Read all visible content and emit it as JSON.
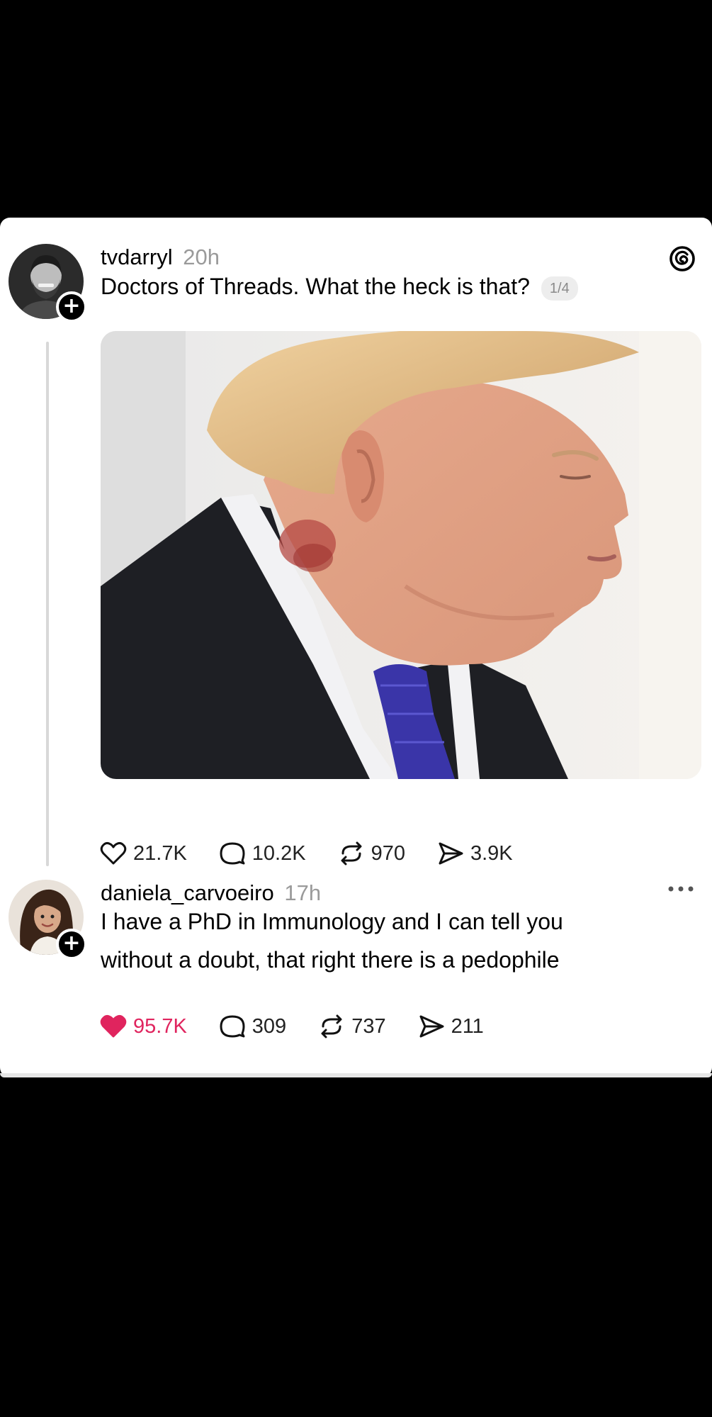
{
  "post": {
    "username": "tvdarryl",
    "time": "20h",
    "text": "Doctors of Threads. What the heck is that?",
    "page_count": "1/4",
    "stats": {
      "likes": "21.7K",
      "replies": "10.2K",
      "reposts": "970",
      "shares": "3.9K"
    }
  },
  "reply": {
    "username": "daniela_carvoeiro",
    "time": "17h",
    "text_line1": "I have a PhD in Immunology and I can tell you",
    "text_line2": "without a doubt, that right there is a pedophile",
    "liked": true,
    "stats": {
      "likes": "95.7K",
      "replies": "309",
      "reposts": "737",
      "shares": "211"
    }
  },
  "icons": {
    "app": "threads-logo-icon",
    "like": "heart-icon",
    "reply": "comment-icon",
    "repost": "repost-icon",
    "share": "share-icon",
    "more": "more-options-icon",
    "follow": "plus-icon"
  },
  "colors": {
    "like_active": "#e0245e",
    "time_text": "#9a9a9a",
    "badge_bg": "#000000"
  }
}
